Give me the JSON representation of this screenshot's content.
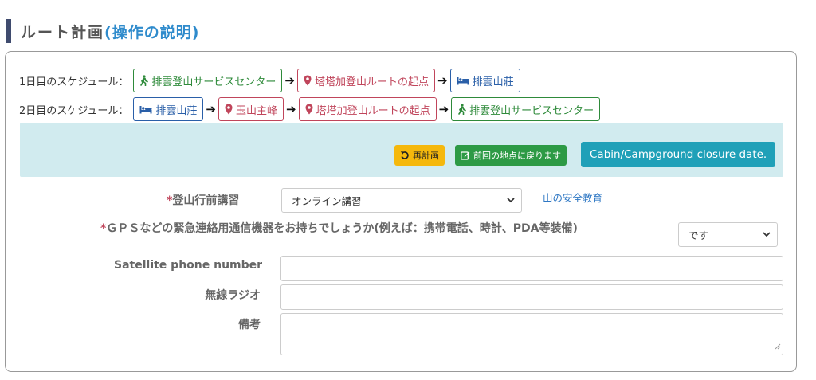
{
  "section": {
    "title": "ルート計画",
    "paren_open": "(",
    "paren_link": "操作の説明",
    "paren_close": ")"
  },
  "schedule": {
    "day1": {
      "label": "1日目のスケジュール：",
      "stops": [
        {
          "type": "hiking",
          "label": "排雲登山サービスセンター"
        },
        {
          "type": "trailhead",
          "label": "塔塔加登山ルートの起点"
        },
        {
          "type": "cabin",
          "label": "排雲山莊"
        }
      ]
    },
    "day2": {
      "label": "2日目のスケジュール：",
      "stops": [
        {
          "type": "cabin",
          "label": "排雲山莊"
        },
        {
          "type": "peak",
          "label": "玉山主峰"
        },
        {
          "type": "trailhead",
          "label": "塔塔加登山ルートの起点"
        },
        {
          "type": "hiking",
          "label": "排雲登山サービスセンター"
        }
      ]
    }
  },
  "actions": {
    "replan": "再計画",
    "back_previous": "前回の地点に戻ります",
    "closure": "Cabin/Campground closure date."
  },
  "form": {
    "lecture": {
      "required_mark": "*",
      "label": "登山行前講習",
      "value": "オンライン講習",
      "link": "山の安全教育"
    },
    "gps": {
      "required_mark": "*",
      "label": "ＧＰＳなどの緊急連絡用通信機器をお持ちでしょうか(例えば：携帯電話、時計、PDA等装備)",
      "value": "です"
    },
    "satellite": {
      "label": "Satellite phone number",
      "value": ""
    },
    "radio": {
      "label": "無線ラジオ",
      "value": ""
    },
    "notes": {
      "label": "備考",
      "value": ""
    }
  },
  "colors": {
    "green": "#2e8a3a",
    "red": "#c0455b",
    "blue": "#2a5fa8",
    "panel": "#d1ebef",
    "warning": "#f5b80c",
    "success": "#2d9a45",
    "info": "#1fa0b8"
  }
}
